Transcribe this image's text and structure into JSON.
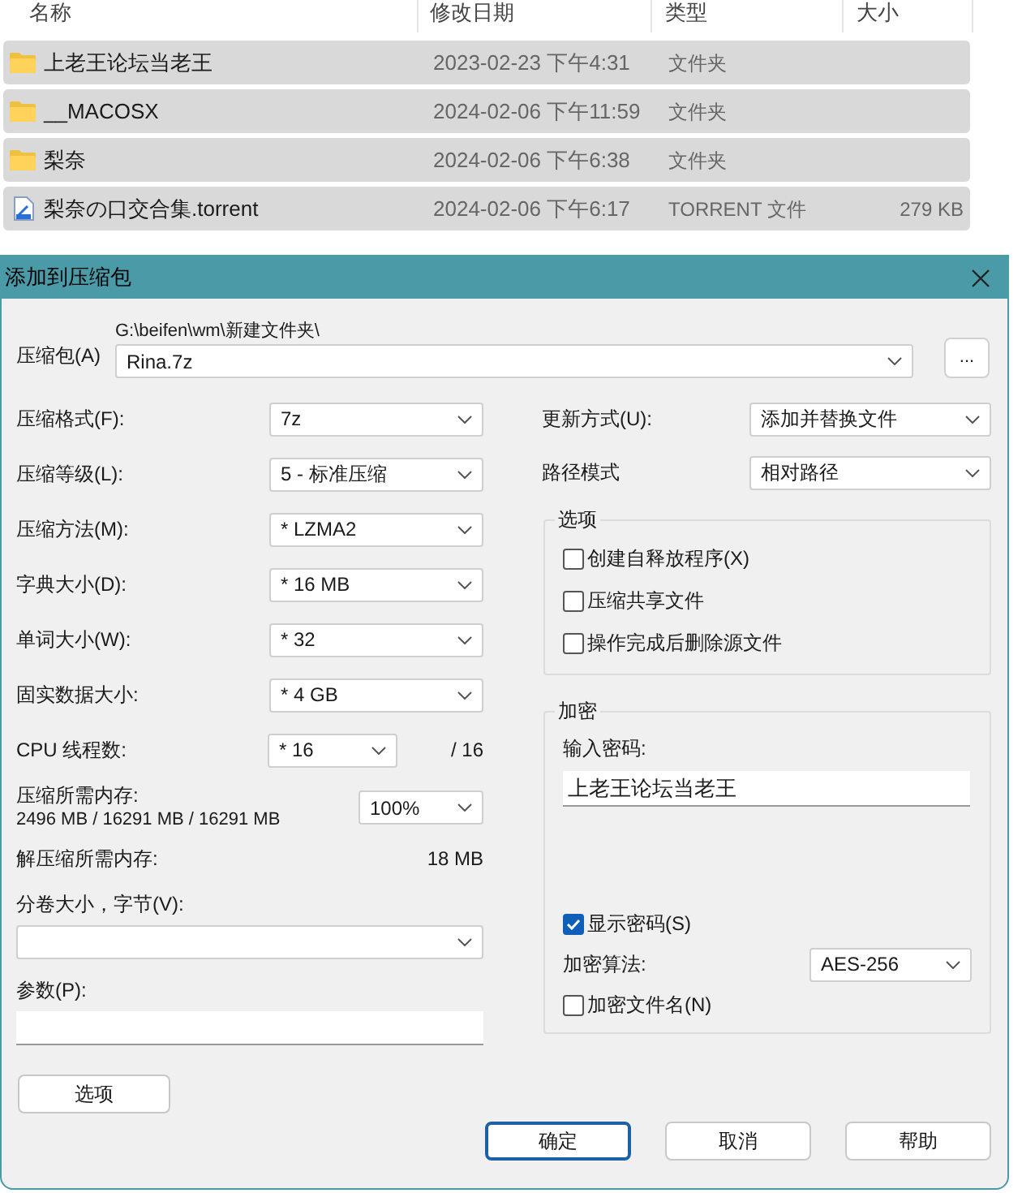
{
  "file_list": {
    "columns": [
      "名称",
      "修改日期",
      "类型",
      "大小"
    ],
    "rows": [
      {
        "kind": "folder",
        "name": "上老王论坛当老王",
        "modified": "2023-02-23 下午4:31",
        "type": "文件夹",
        "selected": true
      },
      {
        "kind": "folder",
        "name": "__MACOSX",
        "modified": "2024-02-06 下午11:59",
        "type": "文件夹",
        "selected": true
      },
      {
        "kind": "folder",
        "name": "梨奈",
        "modified": "2024-02-06 下午6:38",
        "type": "文件夹",
        "selected": true
      },
      {
        "kind": "file",
        "name": "梨奈の口交合集.torrent",
        "modified": "2024-02-06 下午6:17",
        "type": "TORRENT 文件",
        "size": "279 KB",
        "selected": true
      }
    ]
  },
  "dialog": {
    "title": "添加到压缩包",
    "archive": {
      "label": "压缩包(A)",
      "path": "G:\\beifen\\wm\\新建文件夹\\",
      "value": "Rina.7z",
      "browse": "..."
    },
    "settings": [
      {
        "label": "压缩格式(F):",
        "value": "7z"
      },
      {
        "label": "压缩等级(L):",
        "value": "5 - 标准压缩"
      },
      {
        "label": "压缩方法(M):",
        "value": "* LZMA2"
      },
      {
        "label": "字典大小(D):",
        "value": "* 16 MB"
      },
      {
        "label": "单词大小(W):",
        "value": "* 32"
      },
      {
        "label": "固实数据大小:",
        "value": "* 4 GB"
      }
    ],
    "cpu": {
      "label": "CPU 线程数:",
      "value": "* 16",
      "max": "/ 16"
    },
    "compress_memory": {
      "label": "压缩所需内存:",
      "reading": "2496 MB / 16291 MB / 16291 MB",
      "value": "100%"
    },
    "decompress_memory": {
      "label": "解压缩所需内存:",
      "reading": "18 MB"
    },
    "split": {
      "label": "分卷大小，字节(V):"
    },
    "params": {
      "label": "参数(P):"
    },
    "options_button": "选项",
    "update_mode": {
      "label": "更新方式(U):",
      "value": "添加并替换文件"
    },
    "path_mode": {
      "label": "路径模式",
      "value": "相对路径"
    },
    "options_group": {
      "title": "选项",
      "items": [
        {
          "label": "创建自释放程序(X)",
          "checked": false
        },
        {
          "label": "压缩共享文件",
          "checked": false
        },
        {
          "label": "操作完成后删除源文件",
          "checked": false
        }
      ]
    },
    "encryption": {
      "title": "加密",
      "password_label": "输入密码:",
      "password": "上老王论坛当老王",
      "show_password": {
        "label": "显示密码(S)",
        "checked": true
      },
      "method_label": "加密算法:",
      "method": "AES-256",
      "encrypt_names": {
        "label": "加密文件名(N)",
        "checked": false
      }
    },
    "buttons": [
      {
        "label": "确定",
        "focused": true
      },
      {
        "label": "取消",
        "focused": false
      },
      {
        "label": "帮助",
        "focused": false
      }
    ]
  }
}
